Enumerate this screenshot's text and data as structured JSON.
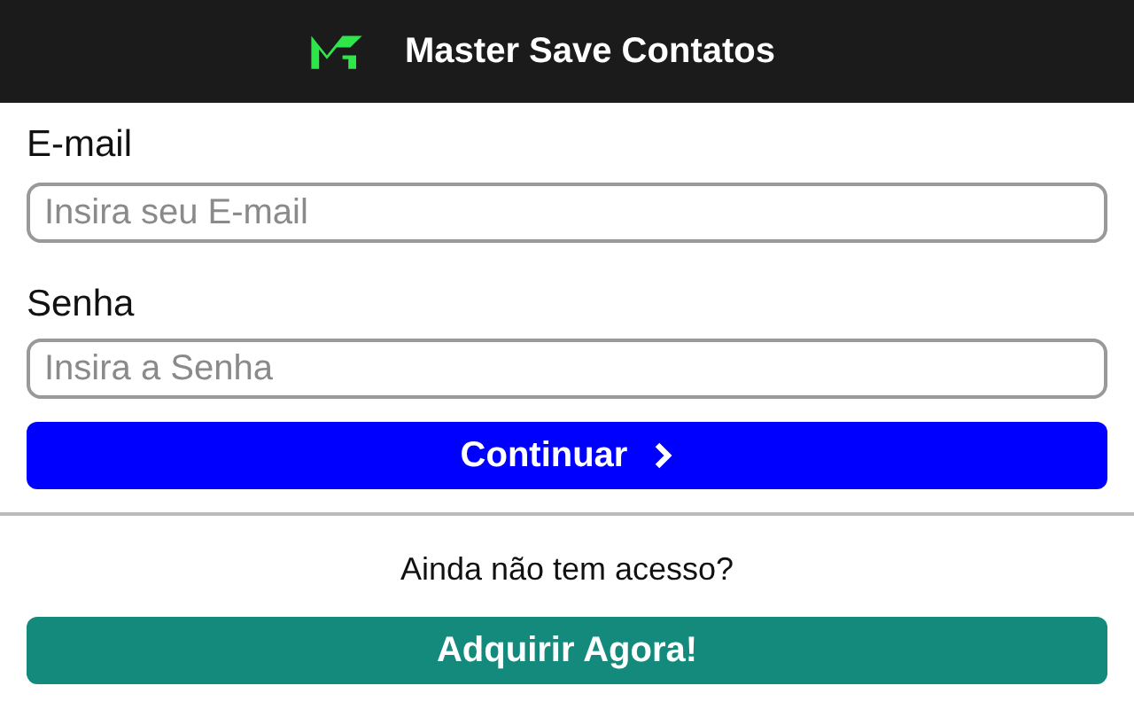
{
  "header": {
    "title": "Master Save Contatos"
  },
  "fields": [
    {
      "label": "E-mail",
      "placeholder": "Insira seu E-mail"
    },
    {
      "label": "Senha",
      "placeholder": "Insira a Senha"
    }
  ],
  "continue_button": {
    "label": "Continuar"
  },
  "signup": {
    "prompt": "Ainda não tem acesso?",
    "button": "Adquirir Agora!"
  }
}
